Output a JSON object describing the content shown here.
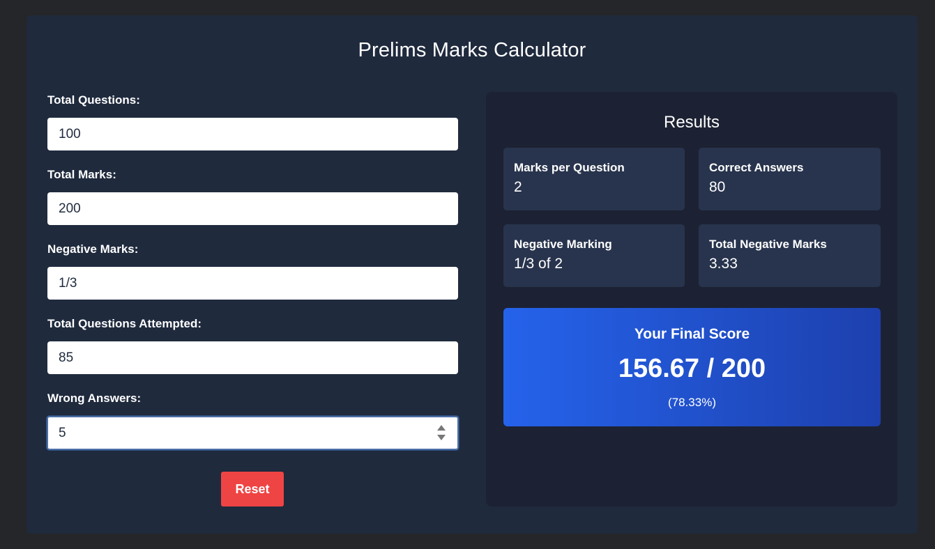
{
  "app": {
    "title": "Prelims Marks Calculator"
  },
  "form": {
    "total_questions": {
      "label": "Total Questions:",
      "value": "100"
    },
    "total_marks": {
      "label": "Total Marks:",
      "value": "200"
    },
    "negative_marks": {
      "label": "Negative Marks:",
      "value": "1/3"
    },
    "questions_attempted": {
      "label": "Total Questions Attempted:",
      "value": "85"
    },
    "wrong_answers": {
      "label": "Wrong Answers:",
      "value": "5"
    },
    "reset_label": "Reset"
  },
  "results": {
    "title": "Results",
    "marks_per_question": {
      "label": "Marks per Question",
      "value": "2"
    },
    "correct_answers": {
      "label": "Correct Answers",
      "value": "80"
    },
    "negative_marking": {
      "label": "Negative Marking",
      "value": "1/3 of 2"
    },
    "total_negative_marks": {
      "label": "Total Negative Marks",
      "value": "3.33"
    },
    "final_score": {
      "title": "Your Final Score",
      "value": "156.67 / 200",
      "percent": "(78.33%)"
    }
  },
  "colors": {
    "page_bg": "#252629",
    "panel_bg": "#1f2a3d",
    "results_bg": "#1c2233",
    "card_bg": "#28344d",
    "accent_blue": "#2563eb",
    "reset_red": "#ef4444"
  },
  "icons": {
    "spinner": "spinner-arrows-icon"
  }
}
